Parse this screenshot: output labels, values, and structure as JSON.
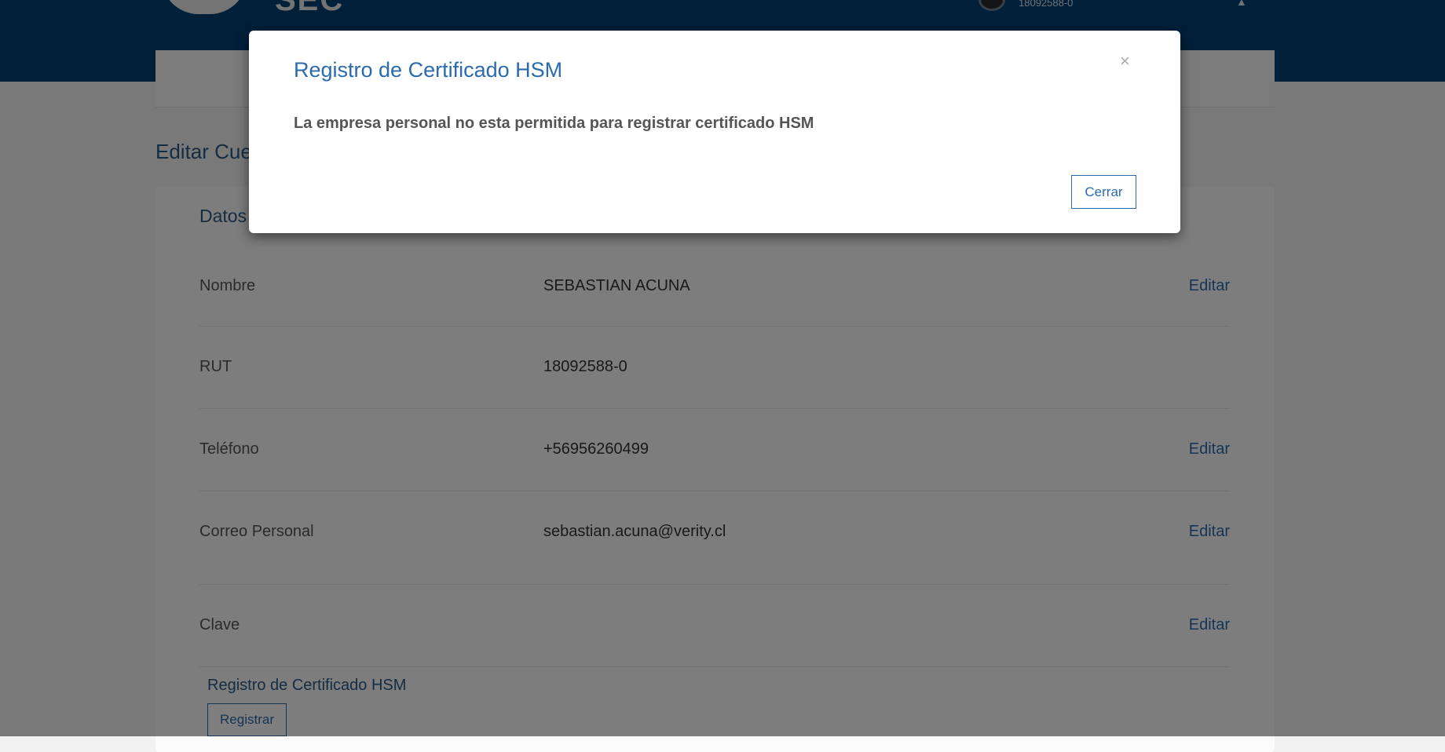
{
  "header": {
    "logo_text": "SEC",
    "user_rut": "18092588-0"
  },
  "page": {
    "title": "Editar Cuenta",
    "card_title": "Datos"
  },
  "rows": [
    {
      "label": "Nombre",
      "value": "SEBASTIAN ACUNA",
      "action": "Editar"
    },
    {
      "label": "RUT",
      "value": "18092588-0"
    },
    {
      "label": "Teléfono",
      "value": "+56956260499",
      "action": "Editar"
    },
    {
      "label": "Correo Personal",
      "value": "sebastian.acuna@verity.cl",
      "action": "Editar"
    },
    {
      "label": "Clave",
      "value": "",
      "action": "Editar"
    }
  ],
  "hsm": {
    "title": "Registro de Certificado HSM",
    "button": "Registrar"
  },
  "modal": {
    "title": "Registro de Certificado HSM",
    "close_symbol": "×",
    "message": "La empresa personal no esta permitida para registrar certificado HSM",
    "button": "Cerrar"
  },
  "colors": {
    "header_bg": "#003f72",
    "accent": "#2a6aad",
    "overlay": "rgba(0,0,0,0.5)"
  },
  "icons": [
    "user-avatar-icon",
    "bell-icon",
    "close-icon"
  ]
}
